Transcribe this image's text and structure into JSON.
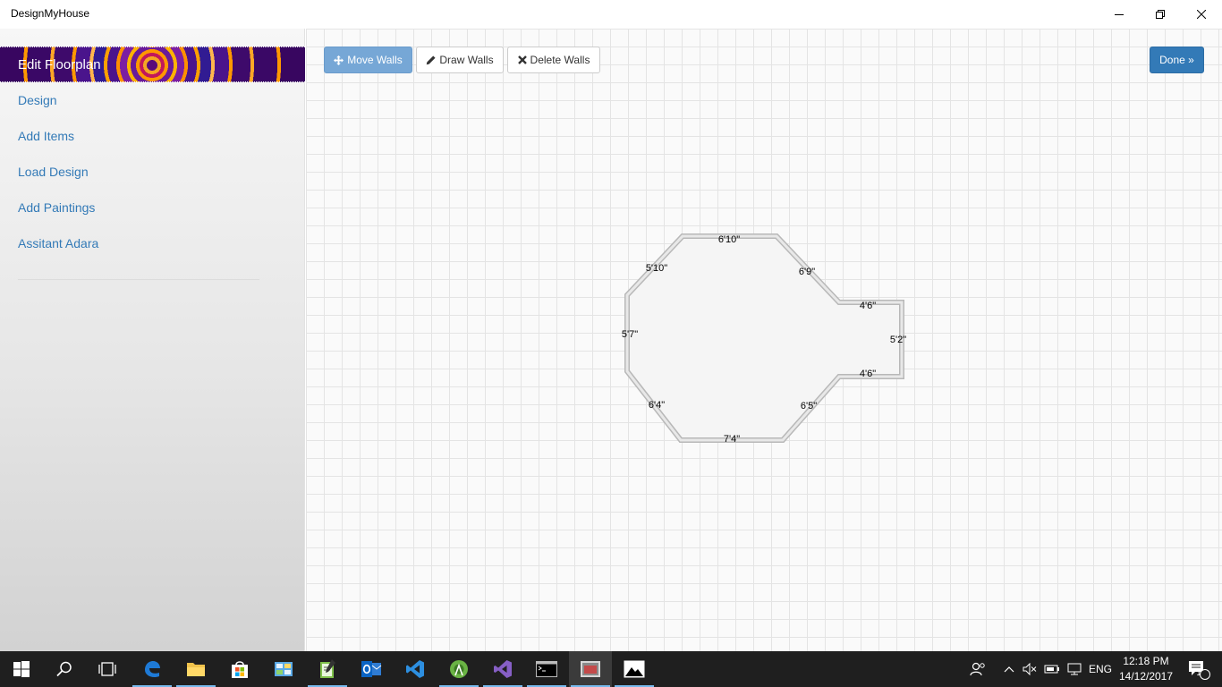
{
  "window": {
    "title": "DesignMyHouse"
  },
  "sidebar": {
    "header": "Edit Floorplan",
    "items": [
      {
        "label": "Design"
      },
      {
        "label": "Add Items"
      },
      {
        "label": "Load Design"
      },
      {
        "label": "Add Paintings"
      },
      {
        "label": "Assitant Adara"
      }
    ]
  },
  "toolbar": {
    "move_label": "Move Walls",
    "draw_label": "Draw Walls",
    "delete_label": "Delete Walls",
    "done_label": "Done »",
    "active_mode": "Move Walls"
  },
  "floorplan": {
    "walls": [
      {
        "length": "6'10\""
      },
      {
        "length": "6'9\""
      },
      {
        "length": "4'6\""
      },
      {
        "length": "5'2\""
      },
      {
        "length": "4'6\""
      },
      {
        "length": "6'5\""
      },
      {
        "length": "7'4\""
      },
      {
        "length": "6'4\""
      },
      {
        "length": "5'7\""
      },
      {
        "length": "5'10\""
      }
    ]
  },
  "taskbar": {
    "apps": [
      {
        "icon": "edge-icon"
      },
      {
        "icon": "file-explorer-icon"
      },
      {
        "icon": "store-icon"
      },
      {
        "icon": "control-panel-icon"
      },
      {
        "icon": "notepad-icon"
      },
      {
        "icon": "outlook-icon"
      },
      {
        "icon": "vscode-icon"
      },
      {
        "icon": "android-studio-icon"
      },
      {
        "icon": "visual-studio-icon"
      },
      {
        "icon": "command-prompt-icon"
      },
      {
        "icon": "designmyhouse-icon"
      },
      {
        "icon": "photos-icon"
      }
    ],
    "language": "ENG",
    "time": "12:18 PM",
    "date": "14/12/2017",
    "notification_count": "1"
  },
  "colors": {
    "link": "#337ab7",
    "primary_button": "#337ab7",
    "active_button": "#76a7d6",
    "taskbar": "#1f1f1f"
  }
}
